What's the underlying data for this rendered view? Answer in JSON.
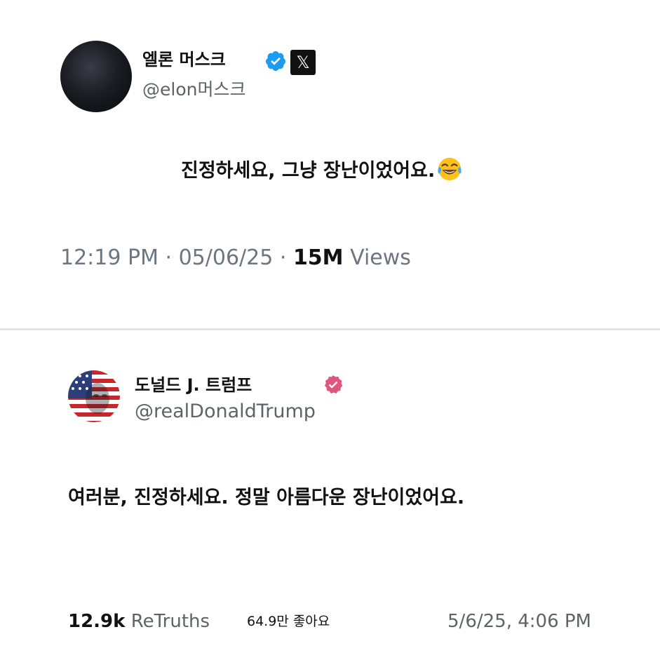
{
  "x_post": {
    "author_name": "엘론 머스크",
    "handle": "@elon머스크",
    "verified_color": "#1d9bf0",
    "platform_icon": "x-logo-icon",
    "text": "진정하세요, 그냥 장난이었어요.",
    "emoji": "face-with-tears-of-joy-icon",
    "meta": {
      "time": "12:19 PM",
      "separator": " · ",
      "date": "05/06/25",
      "views_count": "15M",
      "views_label": "Views"
    }
  },
  "truth_post": {
    "author_name": "도널드 J. 트럼프",
    "handle": "@realDonaldTrump",
    "verified_color": "#e0567e",
    "text": "여러분, 진정하세요. 정말 아름다운 장난이었어요.",
    "meta": {
      "retruths_count": "12.9k",
      "retruths_label": "ReTruths",
      "likes": "64.9만 좋아요",
      "date": "5/6/25, 4:06 PM"
    }
  }
}
